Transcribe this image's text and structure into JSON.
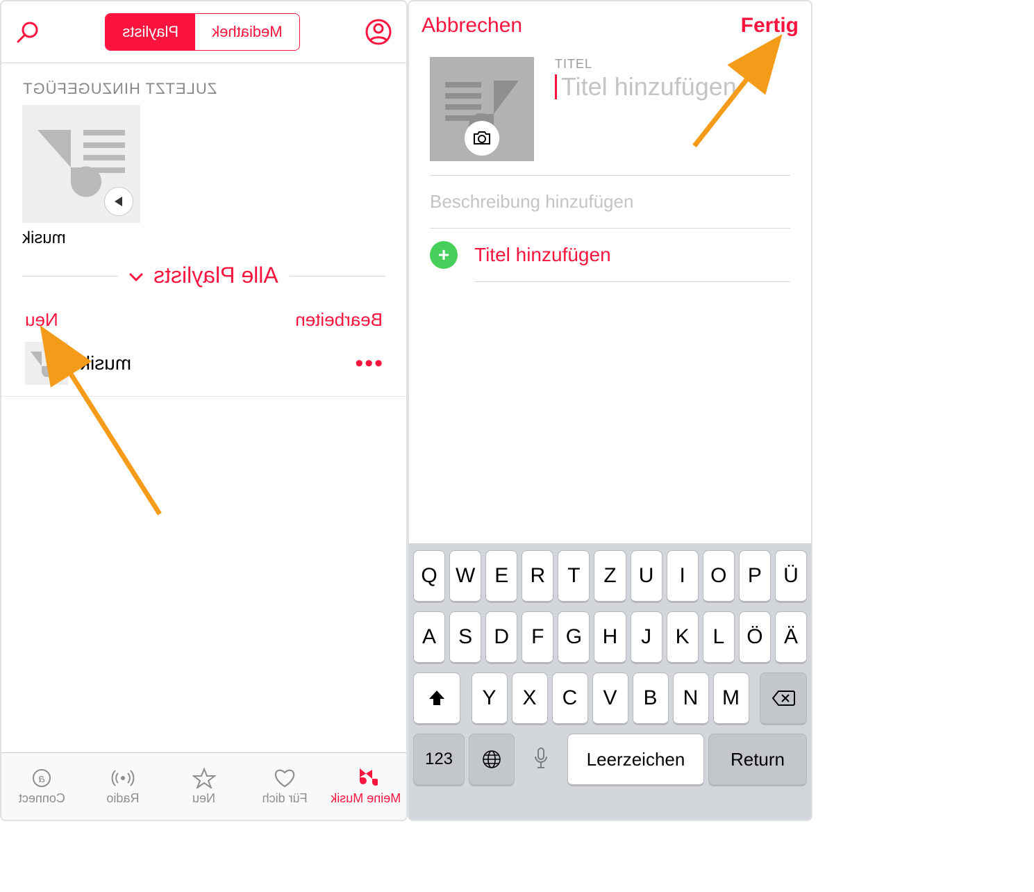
{
  "left": {
    "segmented": {
      "library": "Mediathek",
      "playlists": "Playlists"
    },
    "recently_added": "ZULETZT HINZUGEFÜGT",
    "card_label": "musik",
    "all_playlists": "Alle Playlists",
    "edit": "Bearbeiten",
    "new": "Neu",
    "row_label": "musik",
    "more": "•••",
    "tabs": [
      {
        "label": "Meine Musik"
      },
      {
        "label": "Für dich"
      },
      {
        "label": "Neu"
      },
      {
        "label": "Radio"
      },
      {
        "label": "Connect"
      }
    ]
  },
  "right": {
    "cancel": "Abbrechen",
    "done": "Fertig",
    "title_label": "TITEL",
    "title_placeholder": "Titel hinzufügen",
    "desc_placeholder": "Beschreibung hinzufügen",
    "add_songs": "Titel hinzufügen",
    "keyboard": {
      "row1": [
        "Q",
        "W",
        "E",
        "R",
        "T",
        "Z",
        "U",
        "I",
        "O",
        "P",
        "Ü"
      ],
      "row2": [
        "A",
        "S",
        "D",
        "F",
        "G",
        "H",
        "J",
        "K",
        "L",
        "Ö",
        "Ä"
      ],
      "row3": [
        "Y",
        "X",
        "C",
        "V",
        "B",
        "N",
        "M"
      ],
      "k123": "123",
      "space": "Leerzeichen",
      "return": "Return"
    }
  }
}
